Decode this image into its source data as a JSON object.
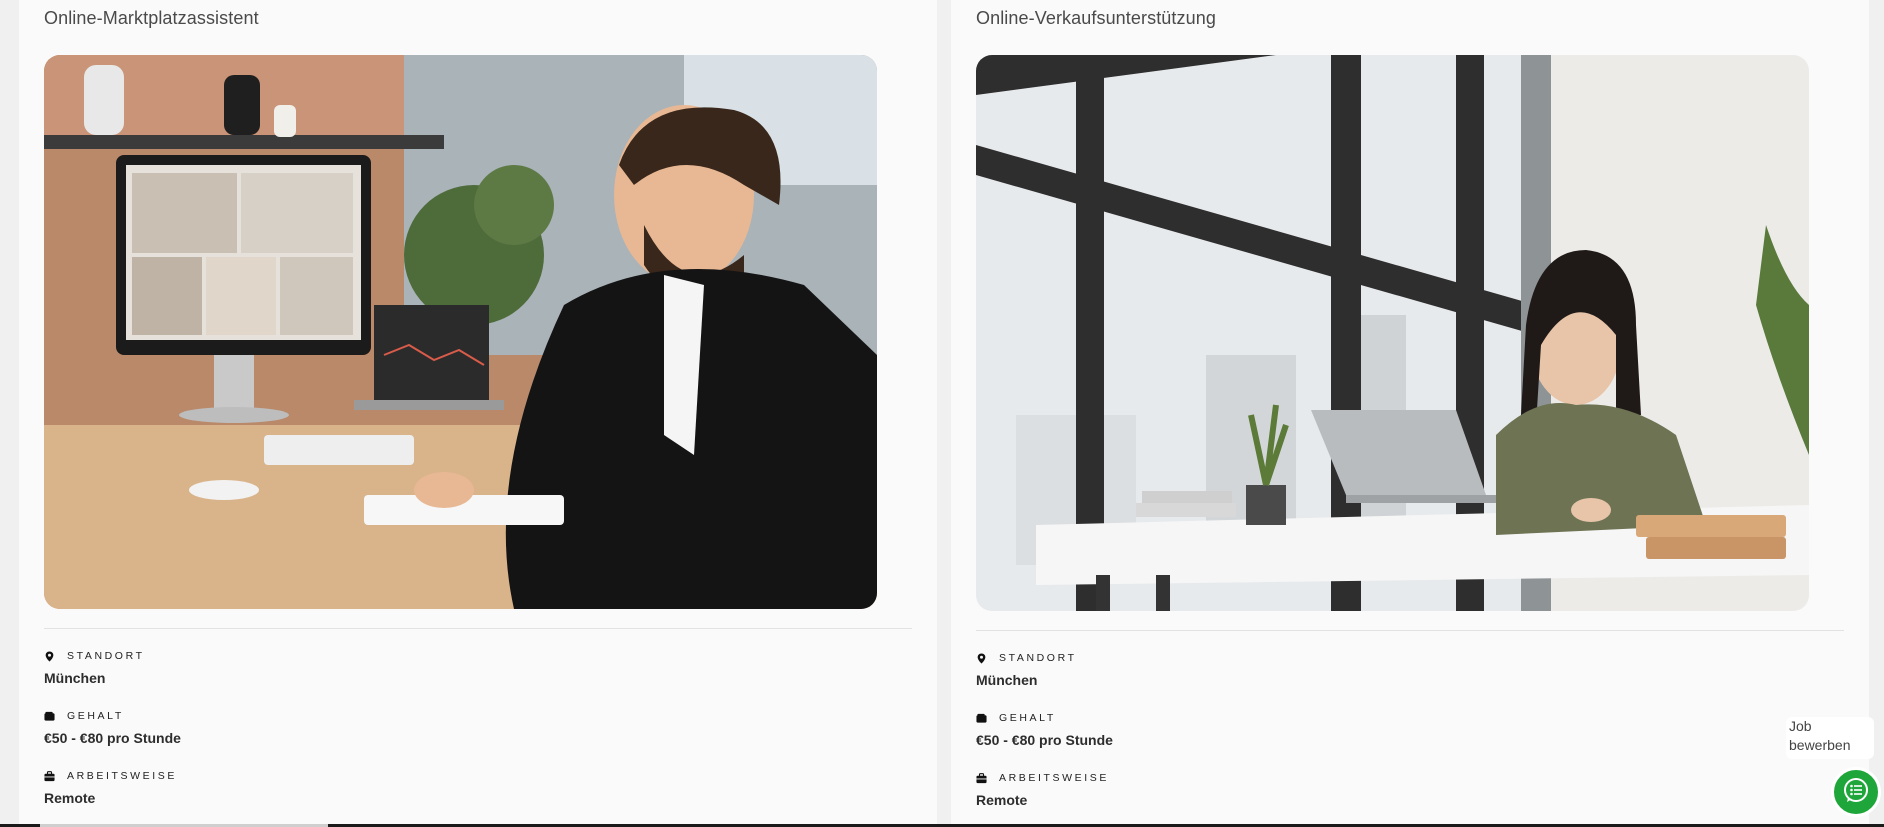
{
  "jobs": [
    {
      "title": "Online-Marktplatzassistent",
      "image_alt": "Mann am Schreibtisch mit Videokonferenz auf dem Monitor",
      "location_label": "STANDORT",
      "location_value": "München",
      "salary_label": "GEHALT",
      "salary_value": "€50 - €80 pro Stunde",
      "work_mode_label": "ARBEITSWEISE",
      "work_mode_value": "Remote"
    },
    {
      "title": "Online-Verkaufsunterstützung",
      "image_alt": "Frau mit Headset am Laptop vor großem Fenster",
      "location_label": "STANDORT",
      "location_value": "München",
      "salary_label": "GEHALT",
      "salary_value": "€50 - €80 pro Stunde",
      "work_mode_label": "ARBEITSWEISE",
      "work_mode_value": "Remote"
    }
  ],
  "floating": {
    "apply_text": "Job bewerben",
    "chat_icon": "list-chat-icon"
  },
  "colors": {
    "accent_green": "#1ea63a",
    "card_bg": "#fafafa",
    "page_bg": "#f0f0f0"
  }
}
